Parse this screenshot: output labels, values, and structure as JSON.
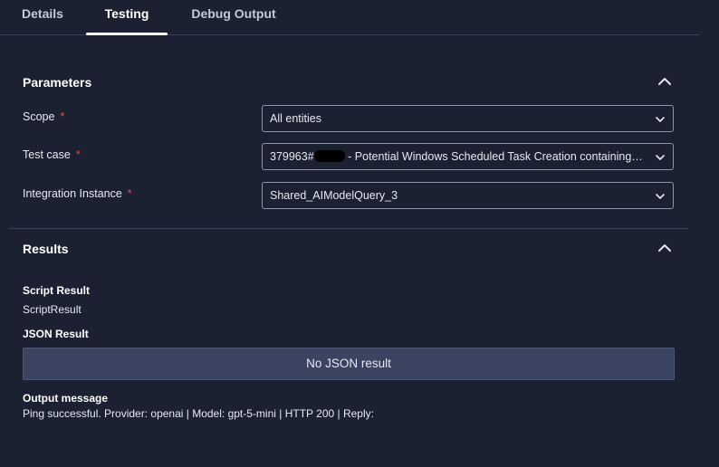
{
  "tabs": [
    {
      "label": "Details"
    },
    {
      "label": "Testing"
    },
    {
      "label": "Debug Output"
    }
  ],
  "parameters": {
    "title": "Parameters",
    "required_marker": "*",
    "scope": {
      "label": "Scope",
      "value": "All entities"
    },
    "test_case": {
      "label": "Test case",
      "value_prefix": "379963#",
      "value_suffix": " - Potential Windows Scheduled Task Creation containing Pro…"
    },
    "integration_instance": {
      "label": "Integration Instance",
      "value": "Shared_AIModelQuery_3"
    }
  },
  "results": {
    "title": "Results",
    "script_result_label": "Script Result",
    "script_result_value": "ScriptResult",
    "json_result_label": "JSON Result",
    "json_result_empty": "No JSON result",
    "output_message_label": "Output message",
    "output_message_value": "Ping successful. Provider: openai | Model: gpt-5-mini | HTTP 200 | Reply:"
  },
  "colors": {
    "background": "#1c2131",
    "accent_active_tab": "#ffffff",
    "required": "#e5484d",
    "json_box": "#3a4460"
  },
  "icons": {
    "collapse": "chevron-up-icon",
    "dropdown": "chevron-down-icon"
  }
}
